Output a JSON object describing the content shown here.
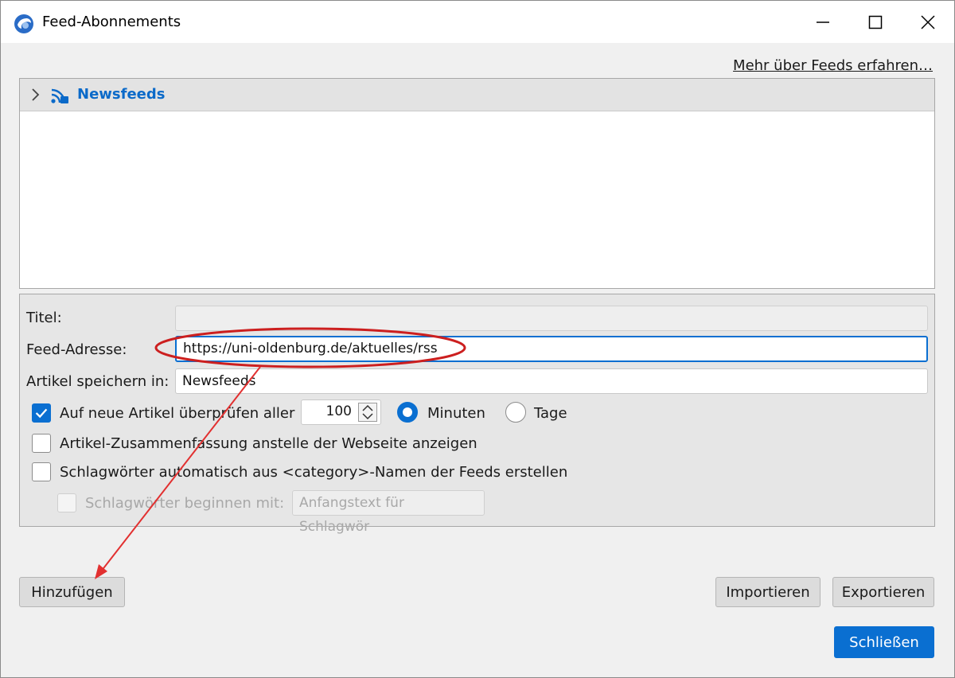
{
  "window": {
    "title": "Feed-Abonnements",
    "app_icon": "thunderbird-icon",
    "controls": [
      "minimize-icon",
      "maximize-icon",
      "close-icon"
    ]
  },
  "header_link": "Mehr über Feeds erfahren…",
  "tree": {
    "root": {
      "label": "Newsfeeds",
      "icon": "rss-icon",
      "expanded": false
    }
  },
  "form": {
    "title_label": "Titel:",
    "title_value": "",
    "address_label": "Feed-Adresse:",
    "address_value": "https://uni-oldenburg.de/aktuelles/rss",
    "folder_label": "Artikel speichern in:",
    "folder_value": "Newsfeeds",
    "check_label": "Auf neue Artikel überprüfen aller",
    "check_checked": true,
    "interval_value": "100",
    "unit_minutes": "Minuten",
    "unit_days": "Tage",
    "unit_selected": "Minuten",
    "summary_label": "Artikel-Zusammenfassung anstelle der Webseite anzeigen",
    "summary_checked": false,
    "tags_label": "Schlagwörter automatisch aus <category>-Namen der Feeds erstellen",
    "tags_checked": false,
    "prefix_label": "Schlagwörter beginnen mit:",
    "prefix_placeholder": "Anfangstext für Schlagwör",
    "prefix_checked": false
  },
  "buttons": {
    "add": "Hinzufügen",
    "import": "Importieren",
    "export": "Exportieren",
    "close": "Schließen"
  },
  "colors": {
    "accent": "#0a6fd1",
    "annotation": "#cc1f1f",
    "tree_label": "#0b6ac9"
  }
}
